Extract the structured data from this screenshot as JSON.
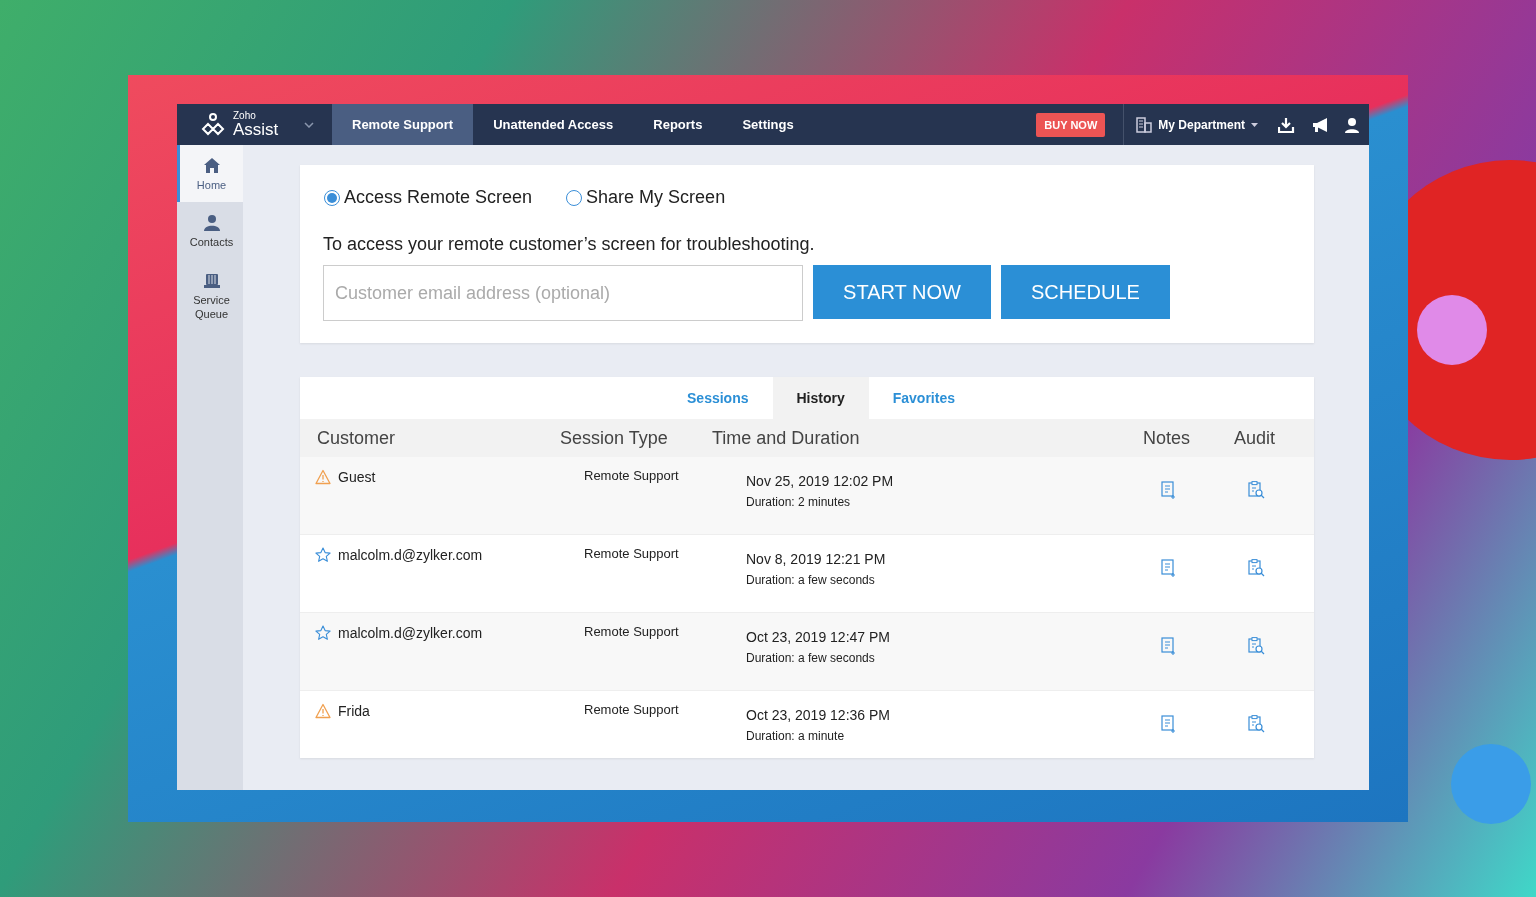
{
  "app": {
    "logo_small": "Zoho",
    "logo_name": "Assist"
  },
  "nav": {
    "items": [
      {
        "label": "Remote Support",
        "selected": true
      },
      {
        "label": "Unattended Access",
        "selected": false
      },
      {
        "label": "Reports",
        "selected": false
      },
      {
        "label": "Settings",
        "selected": false
      }
    ],
    "buy_button": "BUY NOW",
    "department": "My Department"
  },
  "sidebar": {
    "items": [
      {
        "kind": "home",
        "label": "Home",
        "selected": true
      },
      {
        "kind": "contacts",
        "label": "Contacts",
        "selected": false
      },
      {
        "kind": "queue",
        "label": "Service Queue",
        "selected": false
      }
    ]
  },
  "launcher": {
    "modes": [
      {
        "label": "Access Remote Screen",
        "selected": true
      },
      {
        "label": "Share My Screen",
        "selected": false
      }
    ],
    "description": "To access your remote customer’s screen for troubleshooting.",
    "email_placeholder": "Customer email address (optional)",
    "buttons": [
      "START NOW",
      "SCHEDULE"
    ]
  },
  "history": {
    "tabs": [
      {
        "label": "Sessions",
        "selected": false
      },
      {
        "label": "History",
        "selected": true
      },
      {
        "label": "Favorites",
        "selected": false
      }
    ],
    "columns": [
      "Customer",
      "Session Type",
      "Time and Duration",
      "Notes",
      "Audit"
    ],
    "rows": [
      {
        "kind": "warning",
        "customer": "Guest",
        "session_type": "Remote Support",
        "time": "Nov 25, 2019 12:02 PM",
        "duration": "Duration: 2 minutes"
      },
      {
        "kind": "star",
        "customer": "malcolm.d@zylker.com",
        "session_type": "Remote Support",
        "time": "Nov 8, 2019 12:21 PM",
        "duration": "Duration: a few seconds"
      },
      {
        "kind": "star",
        "customer": "malcolm.d@zylker.com",
        "session_type": "Remote Support",
        "time": "Oct 23, 2019 12:47 PM",
        "duration": "Duration: a few seconds"
      },
      {
        "kind": "warning",
        "customer": "Frida",
        "session_type": "Remote Support",
        "time": "Oct 23, 2019 12:36 PM",
        "duration": "Duration: a minute"
      }
    ]
  }
}
